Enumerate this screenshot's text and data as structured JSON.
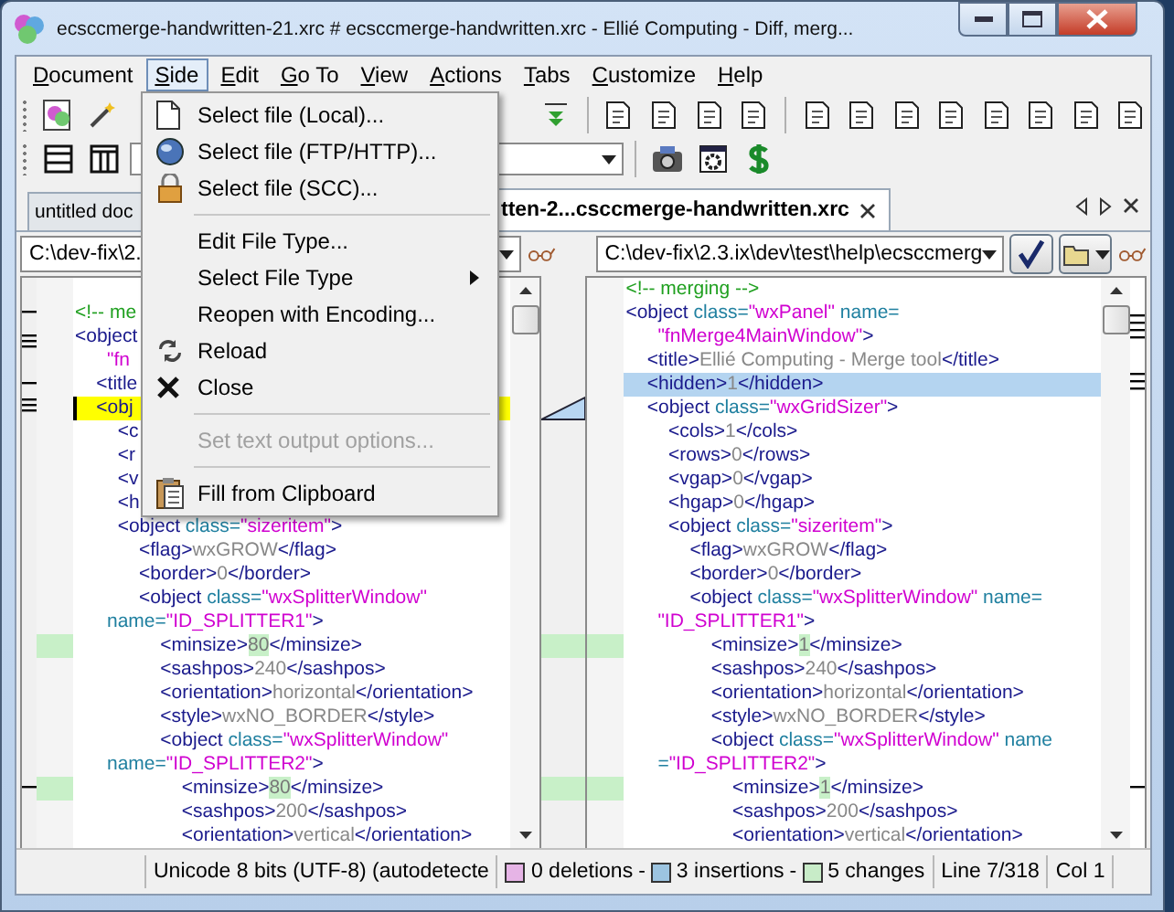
{
  "window": {
    "title": "ecsccmerge-handwritten-21.xrc # ecsccmerge-handwritten.xrc - Ellié Computing - Diff, merg..."
  },
  "menu_bar": [
    {
      "label": "Document",
      "selected": false
    },
    {
      "label": "Side",
      "selected": true
    },
    {
      "label": "Edit",
      "selected": false
    },
    {
      "label": "Go To",
      "selected": false
    },
    {
      "label": "View",
      "selected": false
    },
    {
      "label": "Actions",
      "selected": false
    },
    {
      "label": "Tabs",
      "selected": false
    },
    {
      "label": "Customize",
      "selected": false
    },
    {
      "label": "Help",
      "selected": false
    }
  ],
  "side_menu": [
    {
      "kind": "page",
      "label": "Select file (Local)...",
      "disabled": false
    },
    {
      "kind": "globe",
      "label": "Select file (FTP/HTTP)...",
      "disabled": false
    },
    {
      "kind": "lock",
      "label": "Select file (SCC)...",
      "disabled": false
    },
    {
      "kind": "separator"
    },
    {
      "kind": "plain",
      "label": "Edit File Type...",
      "disabled": false
    },
    {
      "kind": "submenu",
      "label": "Select File Type",
      "disabled": false
    },
    {
      "kind": "plain",
      "label": "Reopen with Encoding...",
      "disabled": false
    },
    {
      "kind": "reload",
      "label": "Reload",
      "disabled": false
    },
    {
      "kind": "close",
      "label": "Close",
      "disabled": false
    },
    {
      "kind": "separator"
    },
    {
      "kind": "plain",
      "label": "Set text output options...",
      "disabled": true
    },
    {
      "kind": "separator"
    },
    {
      "kind": "clipboard",
      "label": "Fill from Clipboard",
      "disabled": false
    }
  ],
  "tabs": [
    {
      "label": "untitled doc",
      "selected": false
    },
    {
      "label": "tten-2...csccmerge-handwritten.xrc",
      "selected": true
    }
  ],
  "left_pane": {
    "path": "C:\\dev-fix\\2.",
    "lines": [
      {
        "kind": "plain",
        "tokens": [
          {
            "kind": "comment",
            "text": "<!-- me"
          }
        ]
      },
      {
        "kind": "plain",
        "tokens": [
          {
            "kind": "tag",
            "text": "<object"
          }
        ]
      },
      {
        "kind": "plain",
        "tokens": [
          {
            "kind": "value",
            "text": "      \"fn"
          }
        ]
      },
      {
        "kind": "plain",
        "tokens": [
          {
            "kind": "tag",
            "text": "    <title"
          }
        ]
      },
      {
        "kind": "current",
        "tokens": [
          {
            "kind": "tag",
            "text": "    <obj"
          }
        ]
      },
      {
        "kind": "plain",
        "tokens": [
          {
            "kind": "tag",
            "text": "        <c"
          }
        ]
      },
      {
        "kind": "plain",
        "tokens": [
          {
            "kind": "tag",
            "text": "        <r"
          }
        ]
      },
      {
        "kind": "plain",
        "tokens": [
          {
            "kind": "tag",
            "text": "        <v"
          }
        ]
      },
      {
        "kind": "plain",
        "tokens": [
          {
            "kind": "tag",
            "text": "        <h"
          }
        ]
      },
      {
        "kind": "plain",
        "tokens": [
          {
            "kind": "tag",
            "text": "        <object "
          },
          {
            "kind": "attr",
            "text": "class="
          },
          {
            "kind": "value",
            "text": "\"sizeritem\""
          },
          {
            "kind": "tag",
            "text": ">"
          }
        ]
      },
      {
        "kind": "plain",
        "tokens": [
          {
            "kind": "tag",
            "text": "            <flag>"
          },
          {
            "kind": "text",
            "text": "wxGROW"
          },
          {
            "kind": "tag",
            "text": "</flag>"
          }
        ]
      },
      {
        "kind": "plain",
        "tokens": [
          {
            "kind": "tag",
            "text": "            <border>"
          },
          {
            "kind": "text",
            "text": "0"
          },
          {
            "kind": "tag",
            "text": "</border>"
          }
        ]
      },
      {
        "kind": "plain",
        "tokens": [
          {
            "kind": "tag",
            "text": "            <object "
          },
          {
            "kind": "attr",
            "text": "class="
          },
          {
            "kind": "value",
            "text": "\"wxSplitterWindow\""
          }
        ]
      },
      {
        "kind": "plain",
        "tokens": [
          {
            "kind": "attr",
            "text": "      name="
          },
          {
            "kind": "value",
            "text": "\"ID_SPLITTER1\""
          },
          {
            "kind": "tag",
            "text": ">"
          }
        ]
      },
      {
        "kind": "changed",
        "tokens": [
          {
            "kind": "tag",
            "text": "                <minsize>"
          },
          {
            "kind": "changed",
            "text": "80"
          },
          {
            "kind": "tag",
            "text": "</minsize>"
          }
        ]
      },
      {
        "kind": "plain",
        "tokens": [
          {
            "kind": "tag",
            "text": "                <sashpos>"
          },
          {
            "kind": "text",
            "text": "240"
          },
          {
            "kind": "tag",
            "text": "</sashpos>"
          }
        ]
      },
      {
        "kind": "plain",
        "tokens": [
          {
            "kind": "tag",
            "text": "                <orientation>"
          },
          {
            "kind": "text",
            "text": "horizontal"
          },
          {
            "kind": "tag",
            "text": "</orientation>"
          }
        ]
      },
      {
        "kind": "plain",
        "tokens": [
          {
            "kind": "tag",
            "text": "                <style>"
          },
          {
            "kind": "text",
            "text": "wxNO_BORDER"
          },
          {
            "kind": "tag",
            "text": "</style>"
          }
        ]
      },
      {
        "kind": "plain",
        "tokens": [
          {
            "kind": "tag",
            "text": "                <object "
          },
          {
            "kind": "attr",
            "text": "class="
          },
          {
            "kind": "value",
            "text": "\"wxSplitterWindow\""
          }
        ]
      },
      {
        "kind": "plain",
        "tokens": [
          {
            "kind": "attr",
            "text": "      name="
          },
          {
            "kind": "value",
            "text": "\"ID_SPLITTER2\""
          },
          {
            "kind": "tag",
            "text": ">"
          }
        ]
      },
      {
        "kind": "changed",
        "tokens": [
          {
            "kind": "tag",
            "text": "                    <minsize>"
          },
          {
            "kind": "changed",
            "text": "80"
          },
          {
            "kind": "tag",
            "text": "</minsize>"
          }
        ]
      },
      {
        "kind": "plain",
        "tokens": [
          {
            "kind": "tag",
            "text": "                    <sashpos>"
          },
          {
            "kind": "text",
            "text": "200"
          },
          {
            "kind": "tag",
            "text": "</sashpos>"
          }
        ]
      },
      {
        "kind": "plain",
        "tokens": [
          {
            "kind": "tag",
            "text": "                    <orientation>"
          },
          {
            "kind": "text",
            "text": "vertical"
          },
          {
            "kind": "tag",
            "text": "</orientation>"
          }
        ]
      }
    ]
  },
  "right_pane": {
    "path": "C:\\dev-fix\\2.3.ix\\dev\\test\\help\\ecsccmerg",
    "lines": [
      {
        "kind": "plain",
        "tokens": [
          {
            "kind": "comment",
            "text": "<!-- merging -->"
          }
        ]
      },
      {
        "kind": "plain",
        "tokens": [
          {
            "kind": "tag",
            "text": "<object "
          },
          {
            "kind": "attr",
            "text": "class="
          },
          {
            "kind": "value",
            "text": "\"wxPanel\""
          },
          {
            "kind": "attr",
            "text": " name="
          }
        ]
      },
      {
        "kind": "plain",
        "tokens": [
          {
            "kind": "value",
            "text": "      \"fnMerge4MainWindow\""
          },
          {
            "kind": "tag",
            "text": ">"
          }
        ]
      },
      {
        "kind": "plain",
        "tokens": [
          {
            "kind": "tag",
            "text": "    <title>"
          },
          {
            "kind": "text",
            "text": "Ellié Computing - Merge tool"
          },
          {
            "kind": "tag",
            "text": "</title>"
          }
        ]
      },
      {
        "kind": "cursor",
        "tokens": [
          {
            "kind": "tag",
            "text": "    <hidden>"
          },
          {
            "kind": "text",
            "text": "1"
          },
          {
            "kind": "tag",
            "text": "</hidden>"
          }
        ]
      },
      {
        "kind": "plain",
        "tokens": [
          {
            "kind": "tag",
            "text": "    <object "
          },
          {
            "kind": "attr",
            "text": "class="
          },
          {
            "kind": "value",
            "text": "\"wxGridSizer\""
          },
          {
            "kind": "tag",
            "text": ">"
          }
        ]
      },
      {
        "kind": "plain",
        "tokens": [
          {
            "kind": "tag",
            "text": "        <cols>"
          },
          {
            "kind": "text",
            "text": "1"
          },
          {
            "kind": "tag",
            "text": "</cols>"
          }
        ]
      },
      {
        "kind": "plain",
        "tokens": [
          {
            "kind": "tag",
            "text": "        <rows>"
          },
          {
            "kind": "text",
            "text": "0"
          },
          {
            "kind": "tag",
            "text": "</rows>"
          }
        ]
      },
      {
        "kind": "plain",
        "tokens": [
          {
            "kind": "tag",
            "text": "        <vgap>"
          },
          {
            "kind": "text",
            "text": "0"
          },
          {
            "kind": "tag",
            "text": "</vgap>"
          }
        ]
      },
      {
        "kind": "plain",
        "tokens": [
          {
            "kind": "tag",
            "text": "        <hgap>"
          },
          {
            "kind": "text",
            "text": "0"
          },
          {
            "kind": "tag",
            "text": "</hgap>"
          }
        ]
      },
      {
        "kind": "plain",
        "tokens": [
          {
            "kind": "tag",
            "text": "        <object "
          },
          {
            "kind": "attr",
            "text": "class="
          },
          {
            "kind": "value",
            "text": "\"sizeritem\""
          },
          {
            "kind": "tag",
            "text": ">"
          }
        ]
      },
      {
        "kind": "plain",
        "tokens": [
          {
            "kind": "tag",
            "text": "            <flag>"
          },
          {
            "kind": "text",
            "text": "wxGROW"
          },
          {
            "kind": "tag",
            "text": "</flag>"
          }
        ]
      },
      {
        "kind": "plain",
        "tokens": [
          {
            "kind": "tag",
            "text": "            <border>"
          },
          {
            "kind": "text",
            "text": "0"
          },
          {
            "kind": "tag",
            "text": "</border>"
          }
        ]
      },
      {
        "kind": "plain",
        "tokens": [
          {
            "kind": "tag",
            "text": "            <object "
          },
          {
            "kind": "attr",
            "text": "class="
          },
          {
            "kind": "value",
            "text": "\"wxSplitterWindow\""
          },
          {
            "kind": "attr",
            "text": " name="
          }
        ]
      },
      {
        "kind": "plain",
        "tokens": [
          {
            "kind": "value",
            "text": "      \"ID_SPLITTER1\""
          },
          {
            "kind": "tag",
            "text": ">"
          }
        ]
      },
      {
        "kind": "changed",
        "tokens": [
          {
            "kind": "tag",
            "text": "                <minsize>"
          },
          {
            "kind": "changed",
            "text": "1"
          },
          {
            "kind": "tag",
            "text": "</minsize>"
          }
        ]
      },
      {
        "kind": "plain",
        "tokens": [
          {
            "kind": "tag",
            "text": "                <sashpos>"
          },
          {
            "kind": "text",
            "text": "240"
          },
          {
            "kind": "tag",
            "text": "</sashpos>"
          }
        ]
      },
      {
        "kind": "plain",
        "tokens": [
          {
            "kind": "tag",
            "text": "                <orientation>"
          },
          {
            "kind": "text",
            "text": "horizontal"
          },
          {
            "kind": "tag",
            "text": "</orientation>"
          }
        ]
      },
      {
        "kind": "plain",
        "tokens": [
          {
            "kind": "tag",
            "text": "                <style>"
          },
          {
            "kind": "text",
            "text": "wxNO_BORDER"
          },
          {
            "kind": "tag",
            "text": "</style>"
          }
        ]
      },
      {
        "kind": "plain",
        "tokens": [
          {
            "kind": "tag",
            "text": "                <object "
          },
          {
            "kind": "attr",
            "text": "class="
          },
          {
            "kind": "value",
            "text": "\"wxSplitterWindow\""
          },
          {
            "kind": "attr",
            "text": " name"
          }
        ]
      },
      {
        "kind": "plain",
        "tokens": [
          {
            "kind": "attr",
            "text": "      ="
          },
          {
            "kind": "value",
            "text": "\"ID_SPLITTER2\""
          },
          {
            "kind": "tag",
            "text": ">"
          }
        ]
      },
      {
        "kind": "changed",
        "tokens": [
          {
            "kind": "tag",
            "text": "                    <minsize>"
          },
          {
            "kind": "changed",
            "text": "1"
          },
          {
            "kind": "tag",
            "text": "</minsize>"
          }
        ]
      },
      {
        "kind": "plain",
        "tokens": [
          {
            "kind": "tag",
            "text": "                    <sashpos>"
          },
          {
            "kind": "text",
            "text": "200"
          },
          {
            "kind": "tag",
            "text": "</sashpos>"
          }
        ]
      },
      {
        "kind": "plain",
        "tokens": [
          {
            "kind": "tag",
            "text": "                    <orientation>"
          },
          {
            "kind": "text",
            "text": "vertical"
          },
          {
            "kind": "tag",
            "text": "</orientation>"
          }
        ]
      }
    ]
  },
  "status_bar": {
    "encoding": "Unicode 8 bits (UTF-8) (autodetecte",
    "counts": [
      {
        "text": "0 deletions",
        "color": "#e6b4e6"
      },
      {
        "text": "3 insertions",
        "color": "#9cc4e0"
      },
      {
        "text": "5 changes",
        "color": "#c8ecc8"
      }
    ],
    "joiner": "-",
    "line": "Line 7/318",
    "column": "Col 1"
  }
}
